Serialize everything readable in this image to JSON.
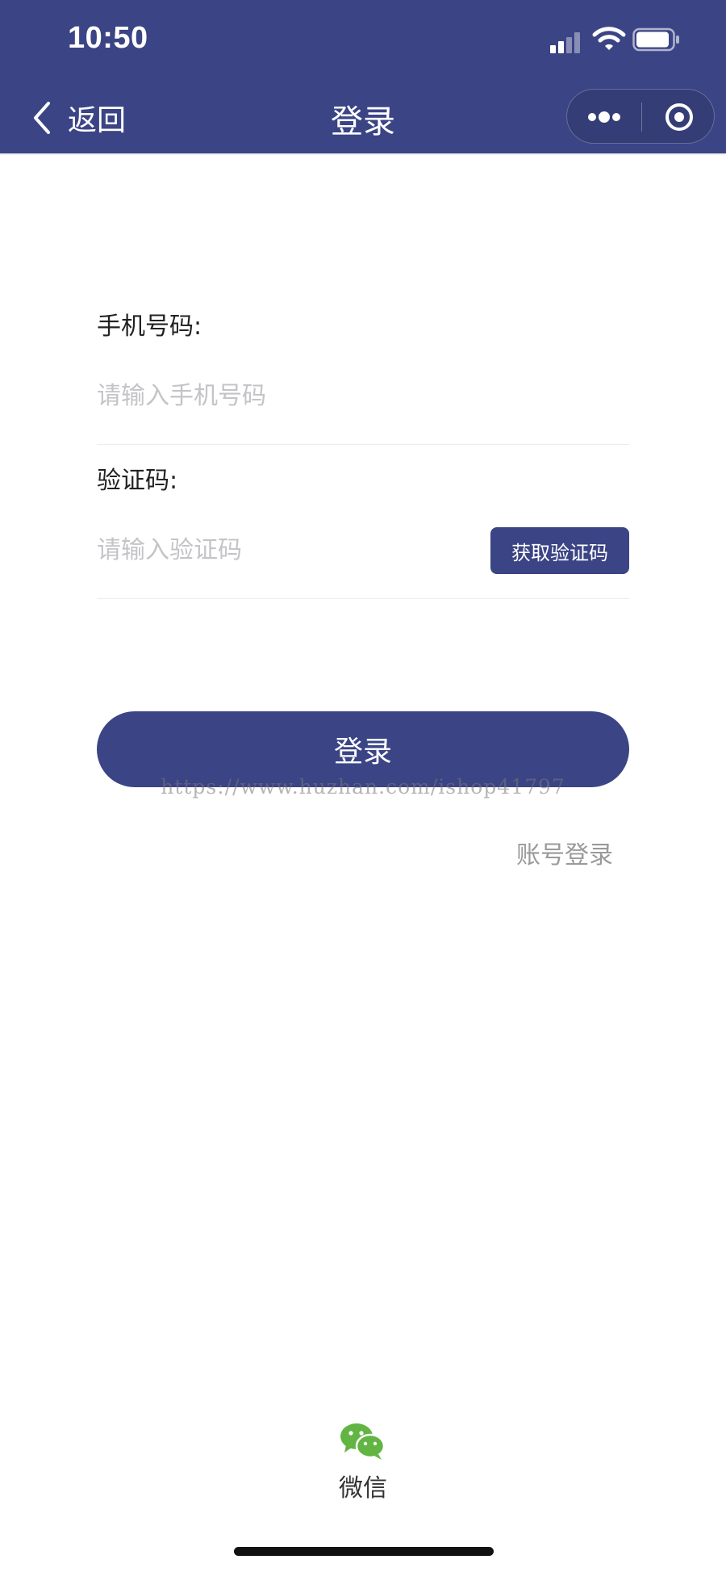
{
  "status_bar": {
    "time": "10:50"
  },
  "nav": {
    "back_label": "返回",
    "title": "登录"
  },
  "form": {
    "phone_label": "手机号码:",
    "phone_placeholder": "请输入手机号码",
    "phone_value": "",
    "code_label": "验证码:",
    "code_placeholder": "请输入验证码",
    "code_value": "",
    "get_code_label": "获取验证码"
  },
  "login_button_label": "登录",
  "watermark": "https://www.huzhan.com/ishop41797",
  "account_login_label": "账号登录",
  "wechat_label": "微信",
  "colors": {
    "brand": "#3b4485",
    "wechat_green": "#62b543",
    "placeholder": "#c4c4c8",
    "link_gray": "#9a9a9a"
  }
}
